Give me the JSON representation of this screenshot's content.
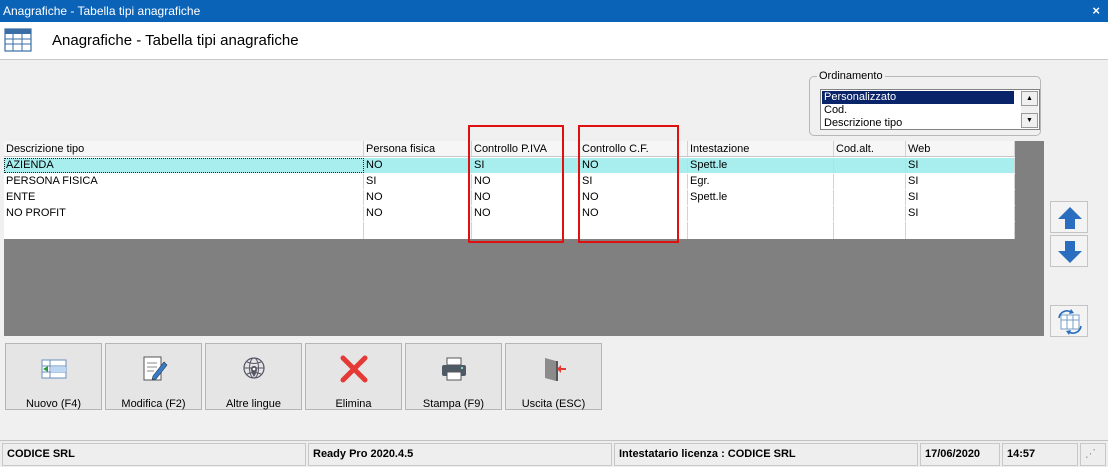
{
  "window": {
    "title": "Anagrafiche - Tabella tipi anagrafiche",
    "close_glyph": "×",
    "header_title": "Anagrafiche - Tabella tipi anagrafiche"
  },
  "sort": {
    "legend": "Ordinamento",
    "options": [
      "Personalizzato",
      "Cod.",
      "Descrizione tipo"
    ],
    "selected": "Personalizzato"
  },
  "table": {
    "columns": [
      "Descrizione tipo",
      "Persona fisica",
      "Controllo P.IVA",
      "Controllo C.F.",
      "Intestazione",
      "Cod.alt.",
      "Web"
    ],
    "rows": [
      [
        "AZIENDA",
        "NO",
        "SI",
        "NO",
        "Spett.le",
        "",
        "SI"
      ],
      [
        "PERSONA FISICA",
        "SI",
        "NO",
        "SI",
        "Egr.",
        "",
        "SI"
      ],
      [
        "ENTE",
        "NO",
        "NO",
        "NO",
        "Spett.le",
        "",
        "SI"
      ],
      [
        "NO PROFIT",
        "NO",
        "NO",
        "NO",
        "",
        "",
        "SI"
      ]
    ],
    "selected_row": 0,
    "highlighted_columns": [
      "Controllo P.IVA",
      "Controllo C.F."
    ]
  },
  "side_buttons": [
    {
      "icon": "arrow-up-icon"
    },
    {
      "icon": "arrow-down-icon"
    },
    {
      "icon": "refresh-icon"
    }
  ],
  "toolbar": [
    {
      "label": "Nuovo (F4)",
      "icon": "new-record-icon"
    },
    {
      "label": "Modifica (F2)",
      "icon": "edit-icon"
    },
    {
      "label": "Altre lingue",
      "icon": "globe-icon"
    },
    {
      "label": "Elimina",
      "icon": "delete-icon"
    },
    {
      "label": "Stampa (F9)",
      "icon": "printer-icon"
    },
    {
      "label": "Uscita (ESC)",
      "icon": "exit-icon"
    }
  ],
  "status": {
    "company": "CODICE SRL",
    "version": "Ready Pro 2020.4.5",
    "license": "Intestatario licenza : CODICE SRL",
    "date": "17/06/2020",
    "time": "14:57"
  },
  "colors": {
    "titlebar": "#0b63b8",
    "selected_row": "#a8eeee",
    "highlight_box": "#e01010",
    "arrow": "#2a6ec0",
    "delete": "#e53935"
  }
}
